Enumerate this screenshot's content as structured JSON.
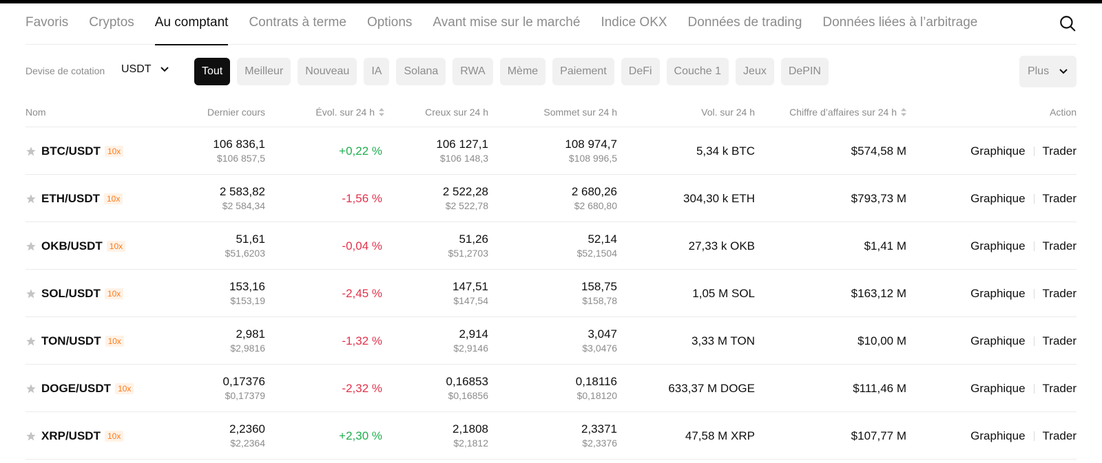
{
  "tabs": [
    {
      "label": "Favoris",
      "active": false
    },
    {
      "label": "Cryptos",
      "active": false
    },
    {
      "label": "Au comptant",
      "active": true
    },
    {
      "label": "Contrats à terme",
      "active": false
    },
    {
      "label": "Options",
      "active": false
    },
    {
      "label": "Avant mise sur le marché",
      "active": false
    },
    {
      "label": "Indice OKX",
      "active": false
    },
    {
      "label": "Données de trading",
      "active": false
    },
    {
      "label": "Données liées à l’arbitrage",
      "active": false
    }
  ],
  "search_icon": "search-icon",
  "filters": {
    "quote_label": "Devise de cotation",
    "quote_value": "USDT",
    "chips": [
      {
        "label": "Tout",
        "active": true
      },
      {
        "label": "Meilleur",
        "active": false
      },
      {
        "label": "Nouveau",
        "active": false
      },
      {
        "label": "IA",
        "active": false
      },
      {
        "label": "Solana",
        "active": false
      },
      {
        "label": "RWA",
        "active": false
      },
      {
        "label": "Mème",
        "active": false
      },
      {
        "label": "Paiement",
        "active": false
      },
      {
        "label": "DeFi",
        "active": false
      },
      {
        "label": "Couche 1",
        "active": false
      },
      {
        "label": "Jeux",
        "active": false
      },
      {
        "label": "DePIN",
        "active": false
      }
    ],
    "more_label": "Plus"
  },
  "table": {
    "headers": {
      "name": "Nom",
      "last": "Dernier cours",
      "change": "Évol. sur 24 h",
      "low": "Creux sur 24 h",
      "high": "Sommet sur 24 h",
      "volume": "Vol. sur 24 h",
      "turnover": "Chiffre d’affaires sur 24 h",
      "action": "Action"
    },
    "rows": [
      {
        "pair": "BTC/USDT",
        "leverage": "10x",
        "last": "106 836,1",
        "last_usd": "$106 857,5",
        "change": "+0,22 %",
        "direction": "up",
        "low": "106 127,1",
        "low_usd": "$106 148,3",
        "high": "108 974,7",
        "high_usd": "$108 996,5",
        "volume": "5,34 k BTC",
        "turnover": "$574,58 M",
        "chart_label": "Graphique",
        "trade_label": "Trader"
      },
      {
        "pair": "ETH/USDT",
        "leverage": "10x",
        "last": "2 583,82",
        "last_usd": "$2 584,34",
        "change": "-1,56 %",
        "direction": "down",
        "low": "2 522,28",
        "low_usd": "$2 522,78",
        "high": "2 680,26",
        "high_usd": "$2 680,80",
        "volume": "304,30 k ETH",
        "turnover": "$793,73 M",
        "chart_label": "Graphique",
        "trade_label": "Trader"
      },
      {
        "pair": "OKB/USDT",
        "leverage": "10x",
        "last": "51,61",
        "last_usd": "$51,6203",
        "change": "-0,04 %",
        "direction": "down",
        "low": "51,26",
        "low_usd": "$51,2703",
        "high": "52,14",
        "high_usd": "$52,1504",
        "volume": "27,33 k OKB",
        "turnover": "$1,41 M",
        "chart_label": "Graphique",
        "trade_label": "Trader"
      },
      {
        "pair": "SOL/USDT",
        "leverage": "10x",
        "last": "153,16",
        "last_usd": "$153,19",
        "change": "-2,45 %",
        "direction": "down",
        "low": "147,51",
        "low_usd": "$147,54",
        "high": "158,75",
        "high_usd": "$158,78",
        "volume": "1,05 M SOL",
        "turnover": "$163,12 M",
        "chart_label": "Graphique",
        "trade_label": "Trader"
      },
      {
        "pair": "TON/USDT",
        "leverage": "10x",
        "last": "2,981",
        "last_usd": "$2,9816",
        "change": "-1,32 %",
        "direction": "down",
        "low": "2,914",
        "low_usd": "$2,9146",
        "high": "3,047",
        "high_usd": "$3,0476",
        "volume": "3,33 M TON",
        "turnover": "$10,00 M",
        "chart_label": "Graphique",
        "trade_label": "Trader"
      },
      {
        "pair": "DOGE/USDT",
        "leverage": "10x",
        "last": "0,17376",
        "last_usd": "$0,17379",
        "change": "-2,32 %",
        "direction": "down",
        "low": "0,16853",
        "low_usd": "$0,16856",
        "high": "0,18116",
        "high_usd": "$0,18120",
        "volume": "633,37 M DOGE",
        "turnover": "$111,46 M",
        "chart_label": "Graphique",
        "trade_label": "Trader"
      },
      {
        "pair": "XRP/USDT",
        "leverage": "10x",
        "last": "2,2360",
        "last_usd": "$2,2364",
        "change": "+2,30 %",
        "direction": "up",
        "low": "2,1808",
        "low_usd": "$2,1812",
        "high": "2,3371",
        "high_usd": "$2,3376",
        "volume": "47,58 M XRP",
        "turnover": "$107,77 M",
        "chart_label": "Graphique",
        "trade_label": "Trader"
      }
    ]
  },
  "colors": {
    "positive": "#1fad4e",
    "negative": "#e3324b",
    "leverage": "#ff7a1a"
  }
}
